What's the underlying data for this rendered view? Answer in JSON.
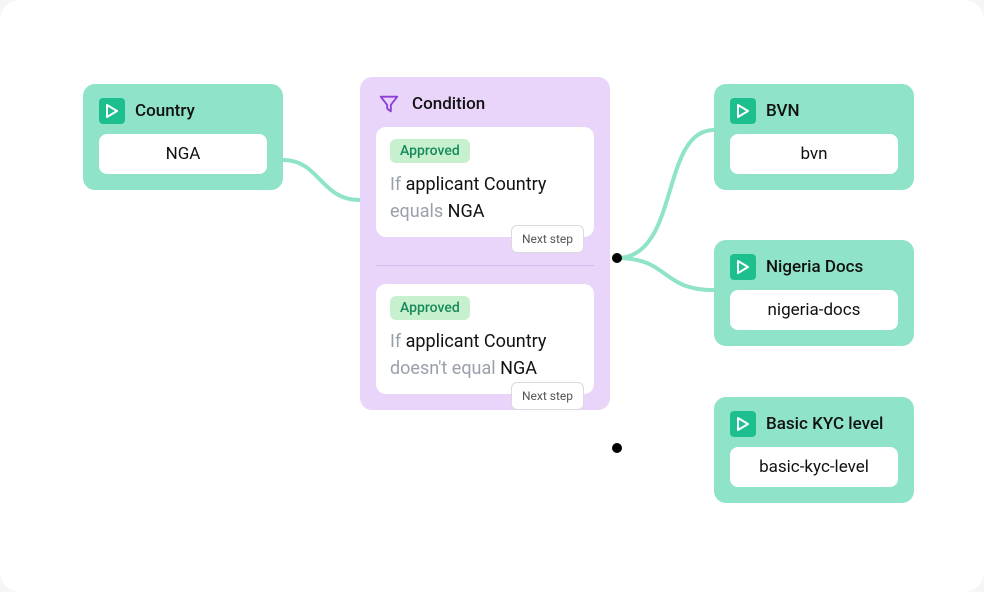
{
  "input_node": {
    "title": "Country",
    "value": "NGA"
  },
  "condition_node": {
    "title": "Condition",
    "rules": [
      {
        "status": "Approved",
        "prefix": "If",
        "subject": "applicant Country",
        "operator": "equals",
        "value": "NGA",
        "next_label": "Next step"
      },
      {
        "status": "Approved",
        "prefix": "If",
        "subject": "applicant Country",
        "operator": "doesn't equal",
        "value": "NGA",
        "next_label": "Next step"
      }
    ]
  },
  "output_nodes": [
    {
      "title": "BVN",
      "value": "bvn"
    },
    {
      "title": "Nigeria Docs",
      "value": "nigeria-docs"
    },
    {
      "title": "Basic KYC level",
      "value": "basic-kyc-level"
    }
  ]
}
